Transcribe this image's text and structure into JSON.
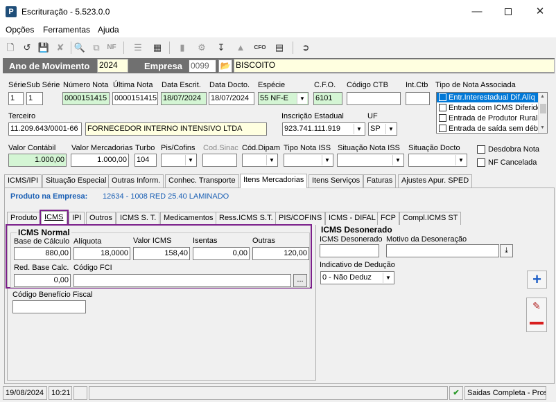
{
  "window": {
    "title": "Escrituração - 5.523.0.0",
    "app_icon": "P"
  },
  "menu": [
    "Opções",
    "Ferramentas",
    "Ajuda"
  ],
  "header": {
    "ano_label": "Ano de Movimento",
    "ano_value": "2024",
    "empresa_label": "Empresa",
    "empresa_code": "0099",
    "empresa_name": "BISCOITO"
  },
  "doc": {
    "serie_label": "Série",
    "serie": "1",
    "subserie_label": "Sub Série",
    "subserie": "1",
    "numero_label": "Número Nota",
    "numero": "0000151415",
    "ultima_label": "Última Nota",
    "ultima": "0000151415",
    "escrit_label": "Data Escrit.",
    "escrit": "18/07/2024",
    "docto_label": "Data Docto.",
    "docto": "18/07/2024",
    "especie_label": "Espécie",
    "especie": "55  NF-E",
    "cfo_label": "C.F.O.",
    "cfo": "6101",
    "ctb_label": "Código CTB",
    "ctb": "",
    "intctb_label": "Int.Ctb",
    "intctb": "",
    "tiponota_label": "Tipo de Nota Associada",
    "tiponota_items": [
      "Entr.Interestadual Dif.Alíq",
      "Entrada com ICMS Diferido",
      "Entrada de Produtor Rural",
      "Entrada de saída sem débi"
    ]
  },
  "terceiro": {
    "label": "Terceiro",
    "cnpj": "11.209.643/0001-66",
    "nome": "FORNECEDOR INTERNO INTENSIVO LTDA",
    "ie_label": "Inscrição Estadual",
    "ie": "923.741.111.919",
    "uf_label": "UF",
    "uf": "SP"
  },
  "valores": {
    "contabil_label": "Valor Contábil",
    "contabil": "1.000,00",
    "merc_label": "Valor Mercadorias",
    "merc": "1.000,00",
    "turbo_label": "Turbo",
    "turbo": "104",
    "piscofins_label": "Pis/Cofins",
    "codsinac_label": "Cod.Sinac",
    "coddipam_label": "Cód.Dipam",
    "tipoiss_label": "Tipo Nota ISS",
    "situacaoiss_label": "Situação Nota ISS",
    "situacaodocto_label": "Situação Docto",
    "desdobra_label": "Desdobra Nota",
    "cancelada_label": "NF Cancelada"
  },
  "tabs1": [
    "ICMS/IPI",
    "Situação Especial",
    "Outras Inform.",
    "Conhec. Transporte",
    "Itens Mercadorias",
    "Itens Serviços",
    "Faturas",
    "Ajustes Apur. SPED"
  ],
  "produto": {
    "label": "Produto na Empresa:",
    "value": "12634 - 1008 RED 25.40 LAMINADO"
  },
  "tabs2": [
    "Produto",
    "ICMS",
    "IPI",
    "Outros",
    "ICMS S. T.",
    "Medicamentos",
    "Ress.ICMS S.T.",
    "PIS/COFINS",
    "ICMS - DIFAL",
    "FCP",
    "Compl.ICMS ST"
  ],
  "icms": {
    "group_label": "ICMS Normal",
    "base_label": "Base de Cálculo",
    "base": "880,00",
    "aliq_label": "Alíquota",
    "aliq": "18,0000",
    "valor_label": "Valor ICMS",
    "valor": "158,40",
    "isentas_label": "Isentas",
    "isentas": "0,00",
    "outras_label": "Outras",
    "outras": "120,00",
    "red_label": "Red. Base Calc.",
    "red": "0,00",
    "fci_label": "Código FCI",
    "fci": "",
    "fci_btn": "...",
    "beneficio_label": "Código Benefício Fiscal",
    "beneficio": ""
  },
  "deson": {
    "group_label": "ICMS Desonerado",
    "valor_label": "ICMS Desonerado",
    "valor": "",
    "motivo_label": "Motivo da Desoneração",
    "motivo": "",
    "deducao_label": "Indicativo de Dedução",
    "deducao": "0 - Não Deduz"
  },
  "status": {
    "date": "19/08/2024",
    "time": "10:21",
    "msg": "Saidas Completa - Pros"
  },
  "colors": {
    "accent": "#7b1f8a",
    "header_bg": "#707070",
    "link": "#1a5fb4",
    "green_field": "#d4f5d4",
    "yellow_field": "#ffffe0"
  }
}
